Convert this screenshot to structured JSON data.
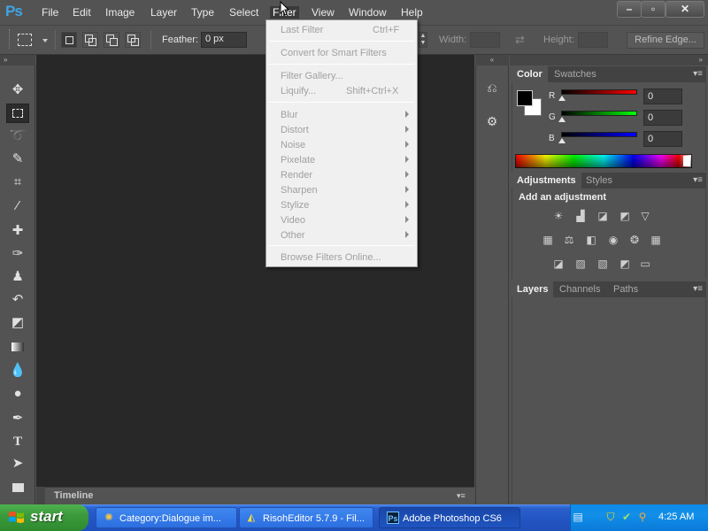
{
  "app": {
    "logo": "Ps"
  },
  "menubar": {
    "items": [
      "File",
      "Edit",
      "Image",
      "Layer",
      "Type",
      "Select",
      "Filter",
      "View",
      "Window",
      "Help"
    ],
    "window_controls": {
      "minimize": "–",
      "restore": "▫",
      "close": "✕"
    }
  },
  "options": {
    "feather_label": "Feather:",
    "feather_value": "0 px",
    "width_label": "Width:",
    "height_label": "Height:",
    "refine_edge": "Refine Edge..."
  },
  "filter_menu": {
    "items": [
      {
        "label": "Last Filter",
        "shortcut": "Ctrl+F"
      },
      {
        "label": "Convert for Smart Filters"
      },
      {
        "label": "Filter Gallery..."
      },
      {
        "label": "Liquify...",
        "shortcut": "Shift+Ctrl+X"
      },
      {
        "label": "Blur",
        "submenu": true
      },
      {
        "label": "Distort",
        "submenu": true
      },
      {
        "label": "Noise",
        "submenu": true
      },
      {
        "label": "Pixelate",
        "submenu": true
      },
      {
        "label": "Render",
        "submenu": true
      },
      {
        "label": "Sharpen",
        "submenu": true
      },
      {
        "label": "Stylize",
        "submenu": true
      },
      {
        "label": "Video",
        "submenu": true
      },
      {
        "label": "Other",
        "submenu": true
      },
      {
        "label": "Browse Filters Online..."
      }
    ]
  },
  "color_panel": {
    "tabs": [
      "Color",
      "Swatches"
    ],
    "channels": [
      {
        "label": "R",
        "value": "0"
      },
      {
        "label": "G",
        "value": "0"
      },
      {
        "label": "B",
        "value": "0"
      }
    ],
    "foreground": "#000000",
    "background": "#ffffff"
  },
  "adjustments_panel": {
    "tabs": [
      "Adjustments",
      "Styles"
    ],
    "heading": "Add an adjustment"
  },
  "layers_panel": {
    "tabs": [
      "Layers",
      "Channels",
      "Paths"
    ]
  },
  "timeline": {
    "label": "Timeline"
  },
  "taskbar": {
    "start": "start",
    "tasks": [
      {
        "label": "Category:Dialogue im..."
      },
      {
        "label": "RisohEditor 5.7.9 - Fil..."
      },
      {
        "label": "Adobe Photoshop CS6"
      }
    ],
    "clock": "4:25 AM"
  },
  "colors": {
    "ps_blue": "#3ea5e3",
    "chrome": "#535353",
    "canvas": "#282828",
    "xp_blue": "#2356c4",
    "xp_green": "#3c9a3c"
  }
}
